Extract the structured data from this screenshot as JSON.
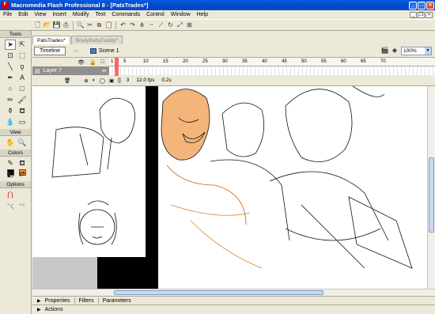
{
  "window": {
    "title": "Macromedia Flash Professional 8 - [PatsTrades*]",
    "app_icon": "F",
    "minimize": "_",
    "maximize": "□",
    "close": "×"
  },
  "menu": [
    "File",
    "Edit",
    "View",
    "Insert",
    "Modify",
    "Text",
    "Commands",
    "Control",
    "Window",
    "Help"
  ],
  "tools_panel": {
    "header": "Tools",
    "view_header": "View",
    "colors_header": "Colors",
    "options_header": "Options",
    "stroke_color": "#000000",
    "fill_color": "#ff8c1a"
  },
  "doc_tabs": [
    {
      "label": "PatsTrades*",
      "active": true
    },
    {
      "label": "BradyBabyDaddy*",
      "active": false
    }
  ],
  "edit_bar": {
    "timeline_button": "Timeline",
    "scene_label": "Scene 1",
    "zoom": "100%"
  },
  "timeline": {
    "layer_name": "Layer 7",
    "ruler_marks": [
      "1",
      "5",
      "10",
      "15",
      "20",
      "25",
      "30",
      "35",
      "40",
      "45",
      "50",
      "55",
      "60",
      "65",
      "70"
    ],
    "current_frame": "3",
    "fps": "12.0 fps",
    "elapsed": "0.2s"
  },
  "panels": {
    "properties": "Properties",
    "filters": "Filters",
    "parameters": "Parameters",
    "actions": "Actions"
  }
}
